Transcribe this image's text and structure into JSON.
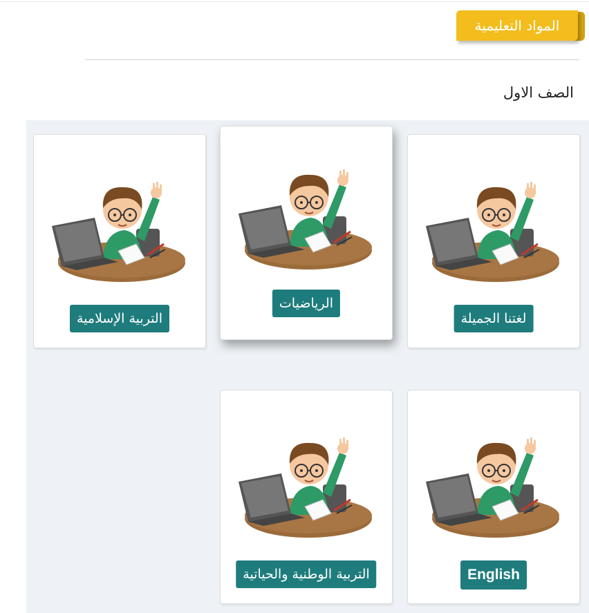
{
  "header": {
    "title": "المواد التعليمية"
  },
  "grade": {
    "title": "الصف الاول"
  },
  "subjects": [
    {
      "label": "لغتنا الجميلة"
    },
    {
      "label": "الرياضيات"
    },
    {
      "label": "التربية الإسلامية"
    },
    {
      "label": "English"
    },
    {
      "label": "التربية الوطنية والحياتية"
    }
  ],
  "colors": {
    "accent": "#f2bd1d",
    "button": "#1f7c7d",
    "panel": "#eef2f6"
  }
}
